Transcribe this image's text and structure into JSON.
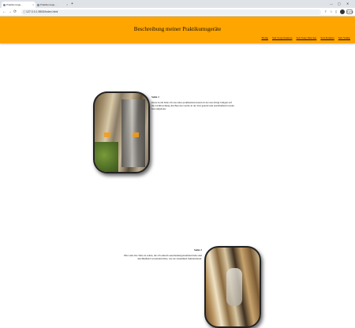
{
  "browser": {
    "tabs": [
      {
        "label": "Praktikumsge…"
      },
      {
        "label": "Praktikumsge…"
      }
    ],
    "new_tab": "+",
    "close_glyph": "×",
    "window_controls": [
      "—",
      "▢",
      "✕"
    ],
    "nav": {
      "back": "←",
      "forward": "→",
      "reload": "⟳"
    },
    "url": "127.0.0.1:5500/index.html",
    "toolbar_button": "Fertig"
  },
  "page": {
    "title": "Beschreibung meiner Praktikumsgeräte",
    "nav_links": [
      "Home",
      "Seit Sony Kamera",
      "Seit Sony Drucker",
      "Seit Kamera",
      "Seit Stamp"
    ],
    "accent_color": "#ffa500"
  },
  "sections": [
    {
      "title": "Seite 1",
      "text": "Diese Gerät habe ich aus einer praktikanten kasten in der uns dringt bringen auf die Lichtbrechung den Bau des Geräts in der Zeit gelernt und anschließend wieder neu aufgebaut."
    },
    {
      "title": "Seite 2",
      "text": "Hier sind alle Teile zu sehen, die ich einzeln auseinandergenommen habe und anschließend verstanden habe, wie sie zusammen funktionieren."
    }
  ]
}
